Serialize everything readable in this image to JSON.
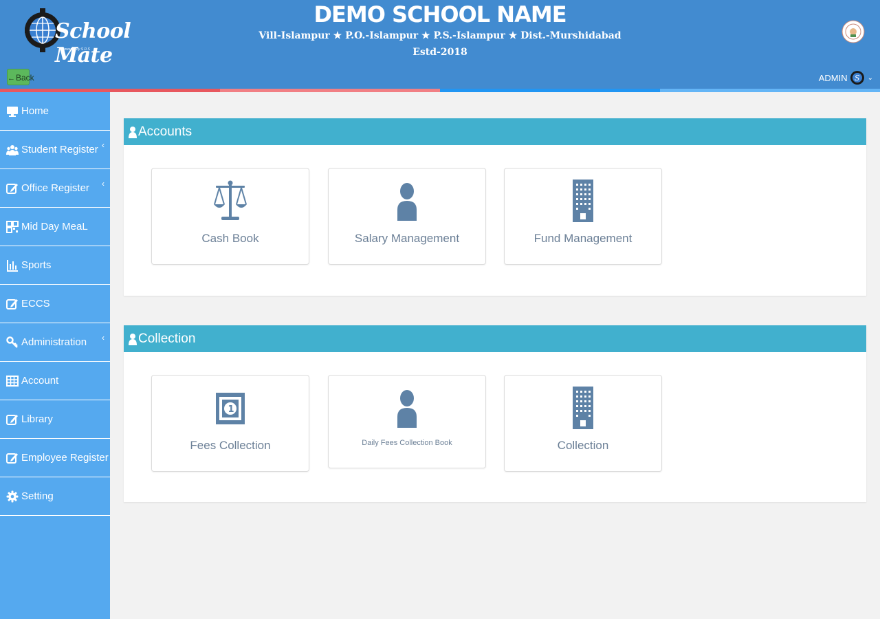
{
  "header": {
    "logo_text": "School Mate",
    "logo_sub": "Powered by S D S",
    "school_name": "DEMO SCHOOL NAME",
    "address": "Vill-Islampur ★ P.O.-Islampur ★ P.S.-Islampur ★ Dist.-Murshidabad",
    "established": "Estd-2018",
    "back_label": "Back",
    "user_label": "ADMIN",
    "colors": {
      "header_bg": "#428bd0",
      "bar_segments": [
        "#e8585f",
        "#f17f84",
        "#2196f3",
        "#64b5f6"
      ]
    }
  },
  "sidebar": {
    "items": [
      {
        "label": "Home",
        "icon": "monitor-icon",
        "has_submenu": false
      },
      {
        "label": "Student Register",
        "icon": "users-icon",
        "has_submenu": true
      },
      {
        "label": "Office Register",
        "icon": "edit-icon",
        "has_submenu": true
      },
      {
        "label": "Mid Day MeaL",
        "icon": "qrcode-icon",
        "has_submenu": false
      },
      {
        "label": "Sports",
        "icon": "bar-chart-icon",
        "has_submenu": false
      },
      {
        "label": "ECCS",
        "icon": "edit-icon",
        "has_submenu": false
      },
      {
        "label": "Administration",
        "icon": "key-icon",
        "has_submenu": true
      },
      {
        "label": "Account",
        "icon": "table-icon",
        "has_submenu": false
      },
      {
        "label": "Library",
        "icon": "edit-icon",
        "has_submenu": false
      },
      {
        "label": "Employee Register",
        "icon": "edit-icon",
        "has_submenu": false
      },
      {
        "label": "Setting",
        "icon": "gear-icon",
        "has_submenu": false
      }
    ],
    "caret": "‹"
  },
  "panels": [
    {
      "title": "Accounts",
      "icon": "user-icon",
      "cards": [
        {
          "label": "Cash Book",
          "icon": "balance-scale-icon"
        },
        {
          "label": "Salary Management",
          "icon": "user-icon"
        },
        {
          "label": "Fund Management",
          "icon": "building-icon"
        }
      ]
    },
    {
      "title": "Collection",
      "icon": "user-icon",
      "cards": [
        {
          "label": "Fees Collection",
          "icon": "money-bill-icon"
        },
        {
          "label": "Daily Fees Collection Book",
          "icon": "user-icon"
        },
        {
          "label": "Collection",
          "icon": "building-icon"
        }
      ]
    }
  ]
}
